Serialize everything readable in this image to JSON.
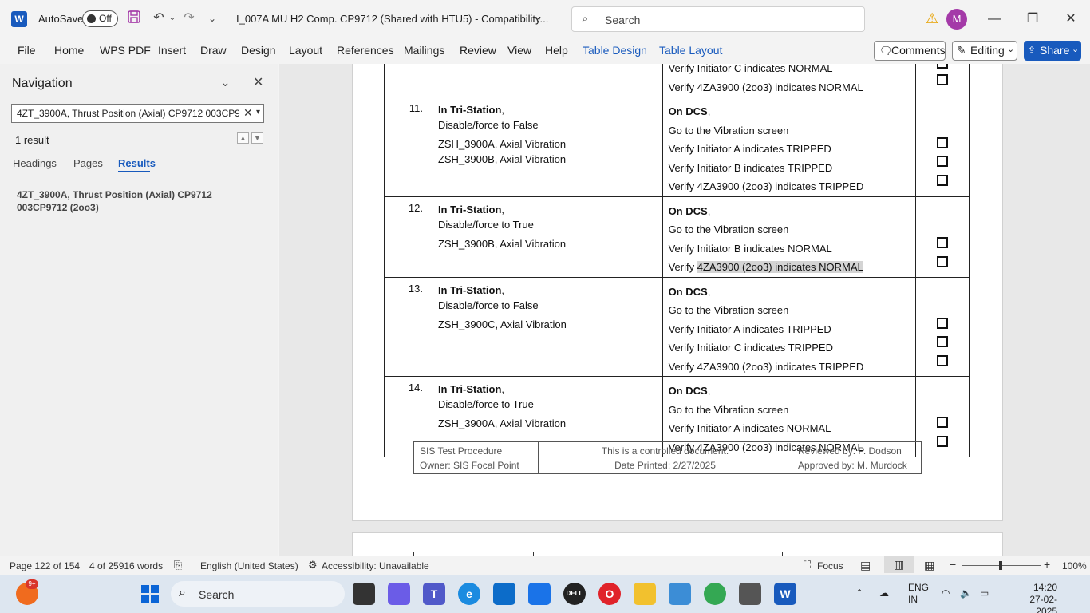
{
  "titlebar": {
    "app_icon": "word-icon",
    "autosave_label": "AutoSave",
    "autosave_state": "Off",
    "doc_title": "I_007A MU H2 Comp. CP9712 (Shared with HTU5)  -  Compatibility...",
    "search_placeholder": "Search",
    "avatar_initial": "M"
  },
  "ribbon": {
    "tabs": [
      "File",
      "Home",
      "WPS PDF",
      "Insert",
      "Draw",
      "Design",
      "Layout",
      "References",
      "Mailings",
      "Review",
      "View",
      "Help",
      "Table Design",
      "Table Layout"
    ],
    "comments_label": "Comments",
    "editing_label": "Editing",
    "share_label": "Share"
  },
  "navigation": {
    "title": "Navigation",
    "search_value": "4ZT_3900A, Thrust Position (Axial) CP9712 003CP9712 (2oo3)",
    "result_count": "1 result",
    "tabs": [
      "Headings",
      "Pages",
      "Results"
    ],
    "active_tab": "Results",
    "result_text": "4ZT_3900A, Thrust Position (Axial) CP9712 003CP9712 (2oo3)"
  },
  "procedure": {
    "top_row": {
      "dcs": [
        "Verify Initiator C indicates NORMAL",
        "Verify 4ZA3900 (2oo3) indicates NORMAL"
      ]
    },
    "steps": [
      {
        "num": "11.",
        "prefix": "In Tri-Station",
        "force": "Disable/force to False",
        "tags": [
          "ZSH_3900A, Axial Vibration",
          "ZSH_3900B, Axial Vibration"
        ],
        "dcs_head": "On DCS",
        "screen": "Go to the Vibration screen",
        "verifies": [
          "Verify Initiator A indicates TRIPPED",
          "Verify Initiator B indicates TRIPPED",
          "Verify 4ZA3900 (2oo3) indicates TRIPPED"
        ]
      },
      {
        "num": "12.",
        "prefix": "In Tri-Station",
        "force": "Disable/force to True",
        "tags": [
          "ZSH_3900B, Axial Vibration"
        ],
        "dcs_head": "On DCS",
        "screen": "Go to the Vibration screen",
        "verifies": [
          "Verify Initiator B indicates NORMAL",
          "Verify 4ZA3900 (2oo3) indicates NORMAL"
        ]
      },
      {
        "num": "13.",
        "prefix": "In Tri-Station",
        "force": "Disable/force to False",
        "tags": [
          "ZSH_3900C, Axial Vibration"
        ],
        "dcs_head": "On DCS",
        "screen": "Go to the Vibration screen",
        "verifies": [
          "Verify Initiator A indicates TRIPPED",
          "Verify Initiator C indicates TRIPPED",
          "Verify 4ZA3900 (2oo3) indicates TRIPPED"
        ]
      },
      {
        "num": "14.",
        "prefix": "In Tri-Station",
        "force": "Disable/force to True",
        "tags": [
          "ZSH_3900A, Axial Vibration"
        ],
        "dcs_head": "On DCS",
        "screen": "Go to the Vibration screen",
        "verifies": [
          "Verify Initiator A indicates NORMAL",
          "Verify 4ZA3900 (2oo3) indicates NORMAL"
        ]
      }
    ]
  },
  "footer": {
    "left1": "SIS Test Procedure",
    "left2": "Owner: SIS Focal Point",
    "mid1": "This is a controlled document.",
    "mid2": "Date Printed: 2/27/2025",
    "right1": "Reviewed by: P. Dodson",
    "right2": "Approved by: M. Murdock"
  },
  "statusbar": {
    "page": "Page 122 of 154",
    "words": "4 of 25916 words",
    "language": "English (United States)",
    "accessibility": "Accessibility: Unavailable",
    "focus": "Focus",
    "zoom": "100%"
  },
  "taskbar": {
    "search_label": "Search",
    "badge": "9+",
    "lang1": "ENG",
    "lang2": "IN",
    "time": "14:20",
    "date": "27-02-2025"
  }
}
